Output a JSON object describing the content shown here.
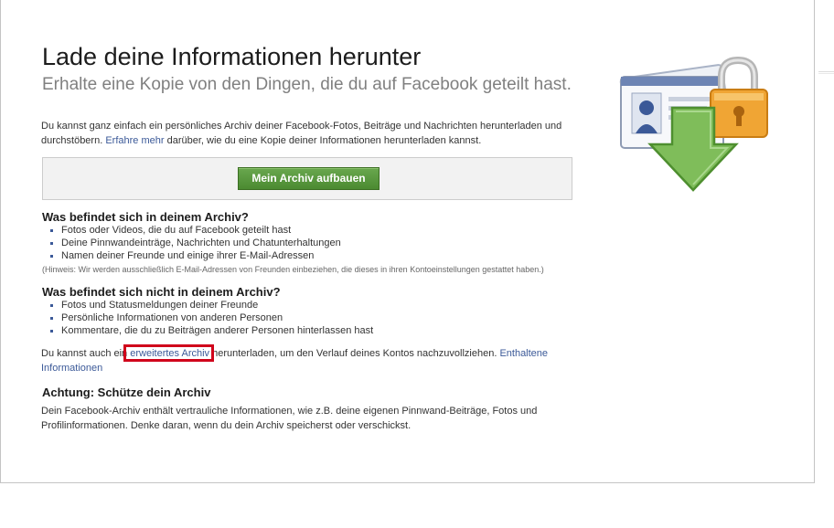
{
  "header": {
    "title": "Lade deine Informationen herunter",
    "subtitle": "Erhalte eine Kopie von den Dingen, die du auf Facebook geteilt hast."
  },
  "intro": {
    "text_before": "Du kannst ganz einfach ein persönliches Archiv deiner Facebook-Fotos, Beiträge und Nachrichten herunterladen und durchstöbern. ",
    "link": "Erfahre mehr",
    "text_after": " darüber, wie du eine Kopie deiner Informationen herunterladen kannst."
  },
  "build_button": {
    "label": "Mein Archiv aufbauen"
  },
  "in_archive": {
    "heading": "Was befindet sich in deinem Archiv?",
    "items": [
      "Fotos oder Videos, die du auf Facebook geteilt hast",
      "Deine Pinnwandeinträge, Nachrichten und Chatunterhaltungen",
      "Namen deiner Freunde und einige ihrer E-Mail-Adressen"
    ],
    "note": "(Hinweis: Wir werden ausschließlich E-Mail-Adressen von Freunden einbeziehen, die dieses in ihren Kontoeinstellungen gestattet haben.)"
  },
  "not_in_archive": {
    "heading": "Was befindet sich nicht in deinem Archiv?",
    "items": [
      "Fotos und Statusmeldungen deiner Freunde",
      "Persönliche Informationen von anderen Personen",
      "Kommentare, die du zu Beiträgen anderer Personen hinterlassen hast"
    ]
  },
  "extended": {
    "text_before": "Du kannst auch ein ",
    "link": "erweitertes Archiv",
    "text_middle": " herunterladen, um den Verlauf deines Kontos nachzuvollziehen. ",
    "link2": "Enthaltene Informationen"
  },
  "warning": {
    "heading": "Achtung: Schütze dein Archiv",
    "text": "Dein Facebook-Archiv enthält vertrauliche Informationen, wie z.B. deine eigenen Pinnwand-Beiträge, Fotos und Profilinformationen. Denke daran, wenn du dein Archiv speicherst oder verschickst."
  },
  "hero_icon": "profile-card-lock-download-icon",
  "colors": {
    "link": "#3b5998",
    "button": "#4b8a31",
    "highlight": "#d0021b",
    "arrow": "#79b65a"
  }
}
